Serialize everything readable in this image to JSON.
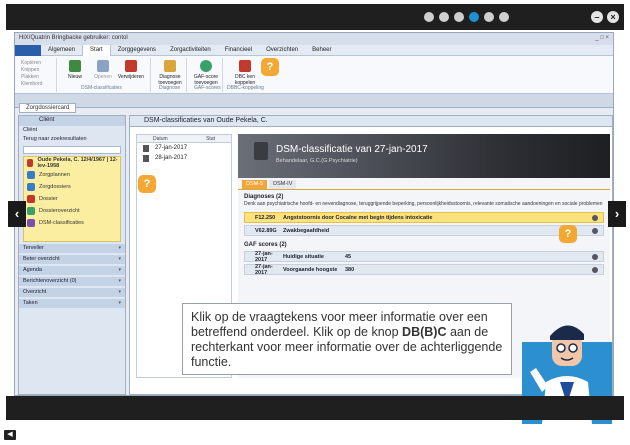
{
  "pager": {
    "dots": 6,
    "active_index": 3
  },
  "window": {
    "title": "HiX/Quatrin Bringbacke gebruiker: contol",
    "controls": "_ □ ×"
  },
  "ribbon": {
    "file_tab": "",
    "tabs": [
      "Algemeen",
      "Start",
      "Zorggegevens",
      "Zorgactiviteiten",
      "Financieel",
      "Overzichten",
      "Beheer"
    ],
    "active_tab": "Start",
    "small_commands": [
      "Kopiëren",
      "Knippen",
      "Plakken",
      "Klembord"
    ],
    "buttons": [
      "Nieuw",
      "Openen",
      "Verwijderen",
      "Diagnose toevoegen",
      "GAF-score toevoegen",
      "DBC ken koppelen"
    ],
    "groups": [
      "DSM-classificaties",
      "Diagnose",
      "GAF-scores",
      "DBBC-koppeling"
    ]
  },
  "doc_tab": "Zorgdossiercard",
  "left_panel": {
    "header": "Cliënt",
    "rows": [
      "Cliënt",
      "Terug naar zoekresultaten"
    ],
    "client_card": [
      "Oude Pekela, C. 12/4/1967 | 12-lev-1958",
      "Zorgplannen",
      "Zorgdossiers",
      "Dossier",
      "Dossieroverzicht",
      "DSM-classificaties"
    ],
    "sections": [
      "Terveller",
      "Beter overzicht",
      "Agenda",
      "Berichtenoverzicht (0)",
      "Overzicht",
      "Taken"
    ]
  },
  "main": {
    "header": "DSM-classificaties van Oude Pekela, C.",
    "date_list": {
      "col_datum": "Datum",
      "col_stat": "Stat",
      "rows": [
        "27-jan-2017",
        "28-jan-2017"
      ]
    },
    "banner_title": "DSM-classificatie van 27-jan-2017",
    "banner_sub": "Behandelaar, G.C.(G.Psychiatrie)",
    "tabs": [
      "DSM-5",
      "DSM-IV"
    ],
    "active_tab": "DSM-5",
    "diag_title": "Diagnoses (2)",
    "diag_text": "Denk aan psychiatrische hoofd- en nevendiagnose, teruggrijpende beperking, persoonlijkheidsstoornis, relevante somatische aandoeningen en sociale problemen",
    "diagnoses": [
      {
        "code": "F12.250",
        "name": "Angststoornis door Cocaïne met begin tijdens intoxicatie"
      },
      {
        "code": "V62.89G",
        "name": "Zwakbegaafdheid"
      }
    ],
    "gaf_title": "GAF scores (2)",
    "gaf_rows": [
      {
        "date": "27-jan-2017",
        "label": "Huidige situatie",
        "value": "45"
      },
      {
        "date": "27-jan-2017",
        "label": "Voorgaande hoogste",
        "value": "380"
      }
    ]
  },
  "tooltip": {
    "before_button": "Klik op de vraagtekens voor meer informatie over een betreffend onderdeel. Klik op de knop ",
    "button_name": "DB(B)C",
    "after_button": " aan de rechterkant voor meer informatie over de achterliggende functie."
  },
  "help_badge": "?",
  "nav": {
    "prev": "‹",
    "next": "›"
  },
  "colors": {
    "accent": "#f3a833",
    "highlight": "#fbe27a",
    "ribbon_file": "#2a5ea8"
  }
}
